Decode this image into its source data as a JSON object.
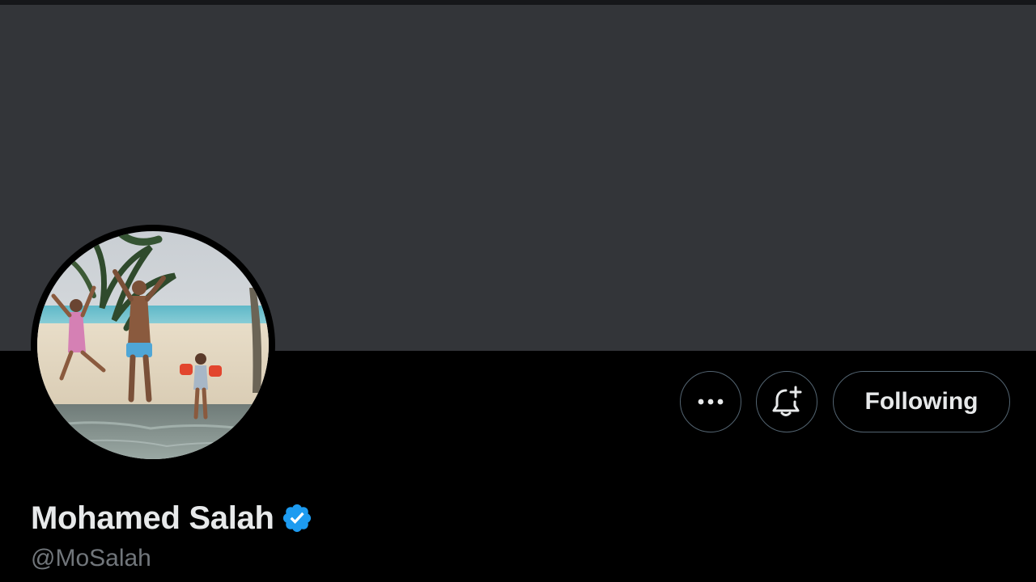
{
  "profile": {
    "display_name": "Mohamed Salah",
    "handle": "@MoSalah",
    "verified": true
  },
  "actions": {
    "more_icon": "more-horizontal-icon",
    "notify_icon": "bell-plus-icon",
    "follow_label": "Following"
  },
  "colors": {
    "banner": "#333539",
    "background": "#000000",
    "verified_badge": "#1d9bf0",
    "primary_text": "#e7e9ea",
    "secondary_text": "#71767b",
    "button_border": "#536471"
  }
}
